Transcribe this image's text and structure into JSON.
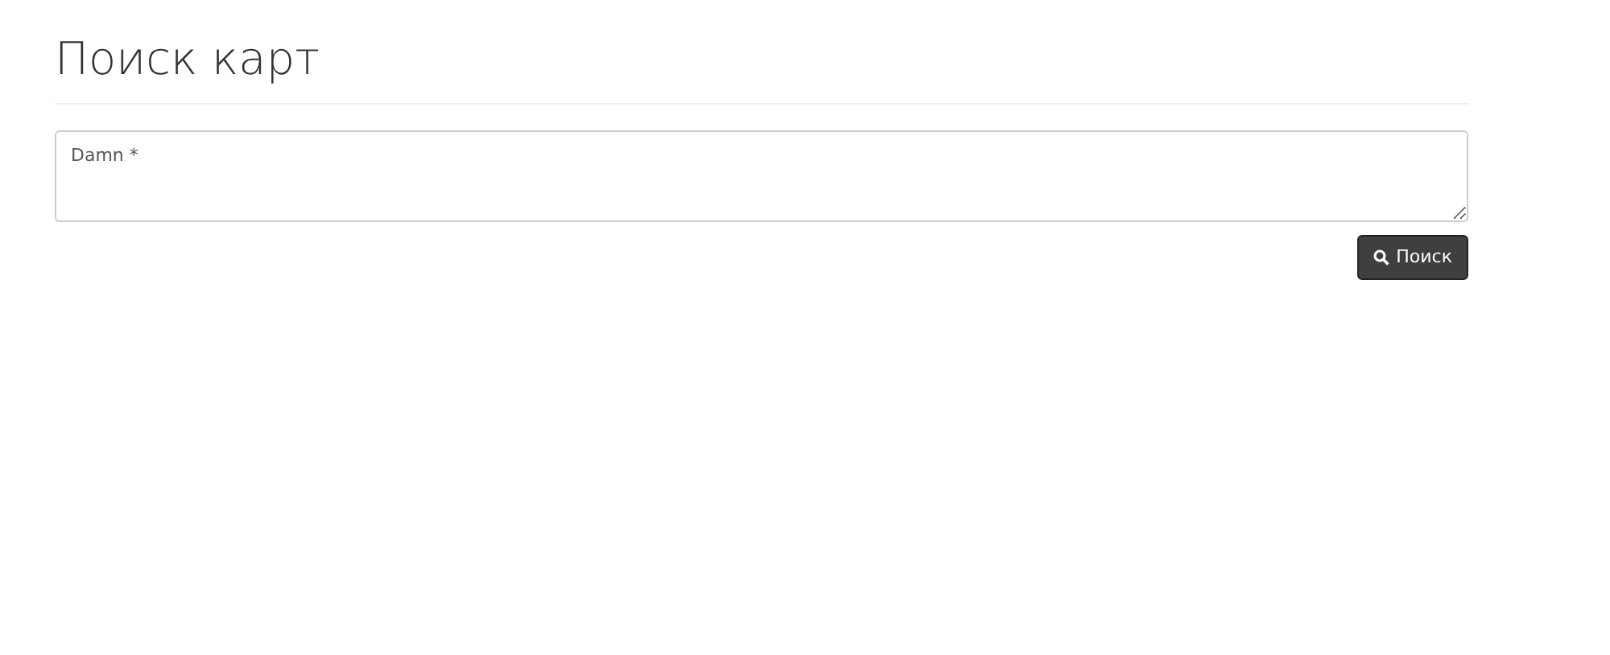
{
  "title": "Поиск карт",
  "search_field": {
    "placeholder": "Damn *"
  },
  "search_button": {
    "label": "Поиск"
  }
}
